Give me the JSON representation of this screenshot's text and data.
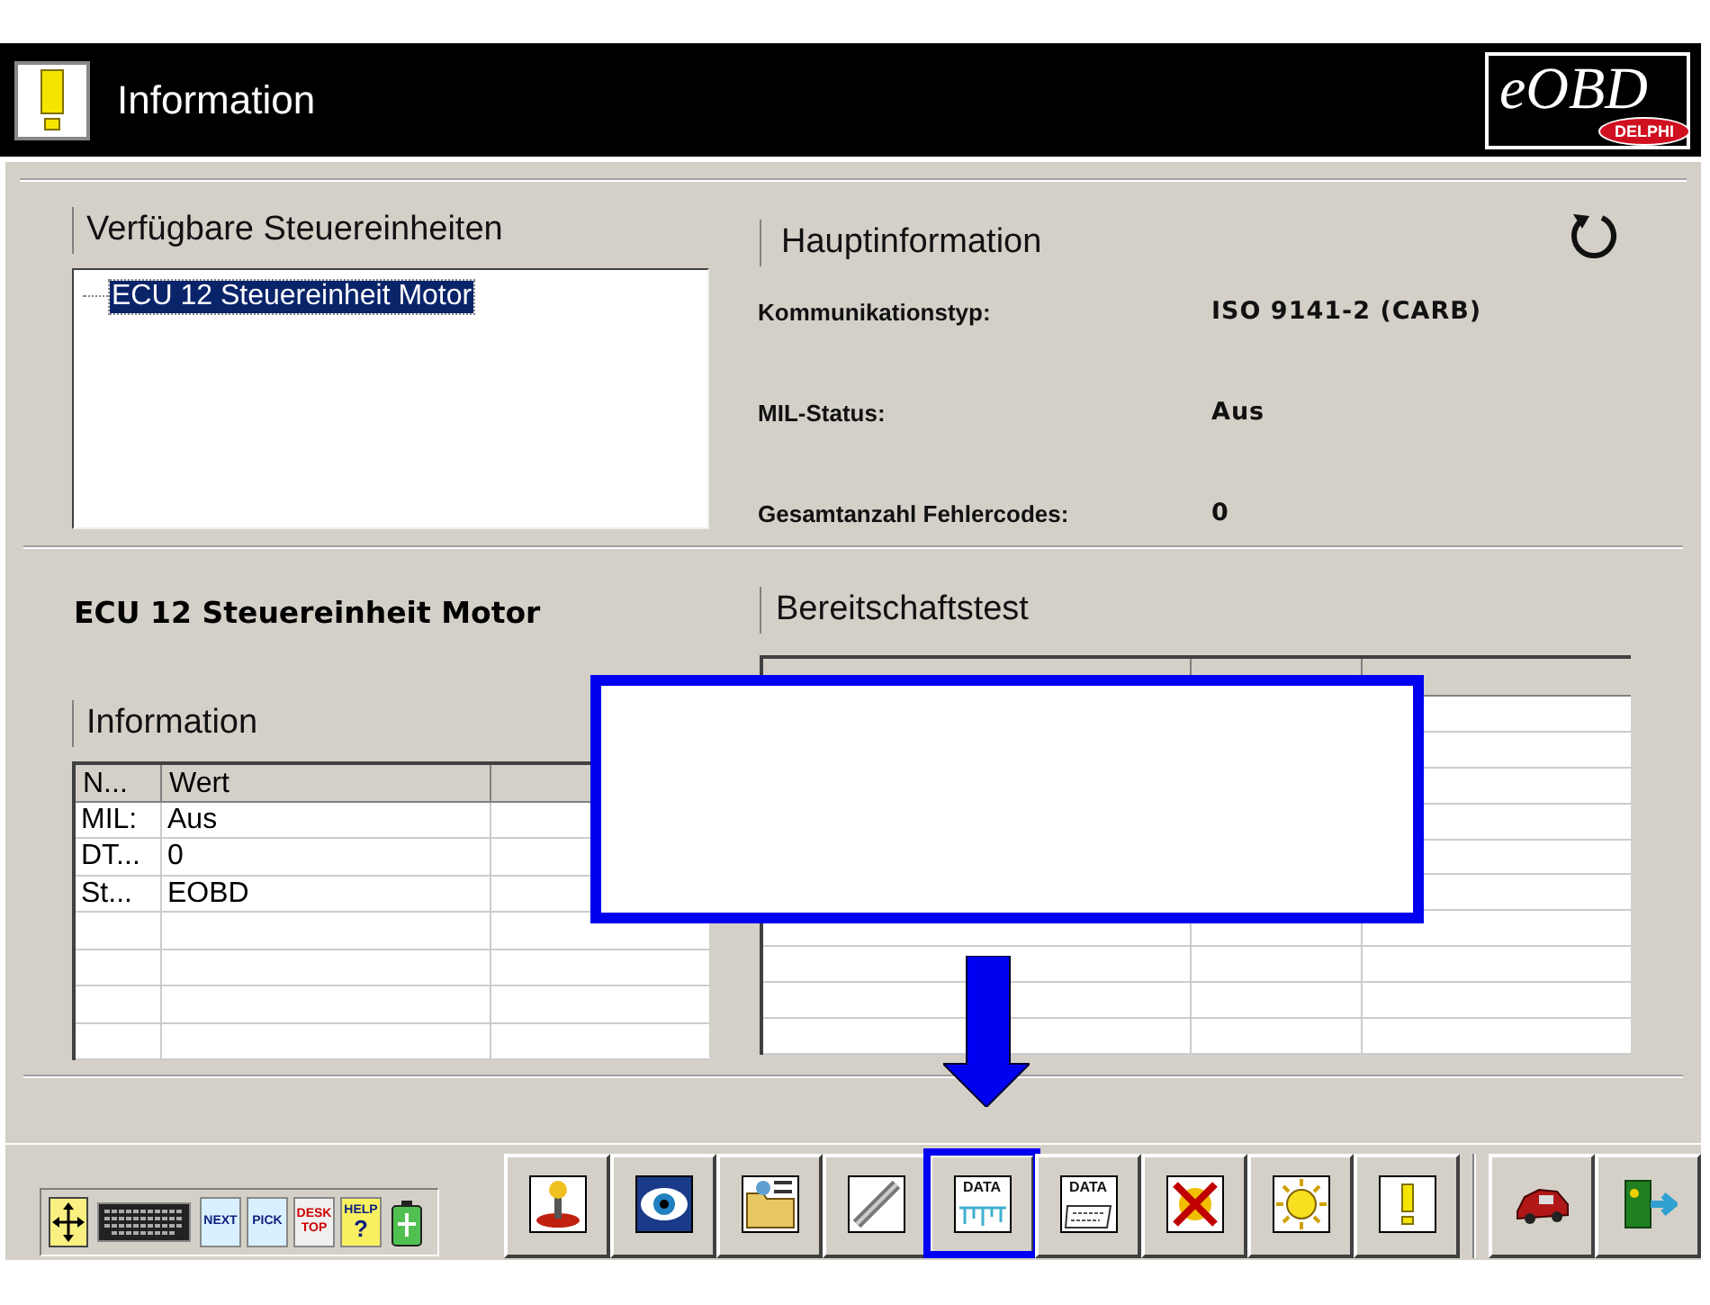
{
  "window": {
    "title": "Information"
  },
  "logo": {
    "text": "eOBD",
    "badge": "DELPHI"
  },
  "ecu_list": {
    "title": "Verfügbare Steuereinheiten",
    "items": [
      {
        "label": "ECU 12 Steuereinheit Motor",
        "selected": true
      }
    ]
  },
  "main_info": {
    "title": "Hauptinformation",
    "rows": [
      {
        "label": "Kommunikationstyp:",
        "value": "ISO 9141-2 (CARB)"
      },
      {
        "label": "MIL-Status:",
        "value": "Aus"
      },
      {
        "label": "Gesamtanzahl Fehlercodes:",
        "value": "0"
      }
    ]
  },
  "selected_ecu": "ECU 12 Steuereinheit Motor",
  "info_table": {
    "title": "Information",
    "columns": [
      "N...",
      "Wert"
    ],
    "rows": [
      [
        "MIL:",
        "Aus"
      ],
      [
        "DT...",
        "0"
      ],
      [
        "St...",
        "EOBD"
      ]
    ]
  },
  "readiness": {
    "title": "Bereitschaftstest"
  },
  "toolbar": {
    "small_tools": [
      {
        "kind": "move"
      },
      {
        "kind": "keyboard"
      },
      {
        "kind": "next",
        "label": "NEXT"
      },
      {
        "kind": "pick",
        "label": "PICK"
      },
      {
        "kind": "desktop",
        "label": "DESK TOP"
      },
      {
        "kind": "help",
        "label": "HELP",
        "glyph": "?"
      },
      {
        "kind": "battery"
      }
    ],
    "main_buttons": [
      {
        "kind": "joystick",
        "highlighted": false
      },
      {
        "kind": "eye",
        "highlighted": false
      },
      {
        "kind": "folder",
        "highlighted": false
      },
      {
        "kind": "sensor",
        "highlighted": false
      },
      {
        "kind": "data-graph",
        "label": "DATA",
        "highlighted": true
      },
      {
        "kind": "data-list",
        "label": "DATA",
        "highlighted": false
      },
      {
        "kind": "cross",
        "highlighted": false
      },
      {
        "kind": "bulb",
        "highlighted": false
      },
      {
        "kind": "alert",
        "highlighted": false
      }
    ],
    "end_buttons": [
      {
        "kind": "car",
        "highlighted": false
      },
      {
        "kind": "exit",
        "highlighted": false
      }
    ]
  },
  "annotation": {
    "callout_box": true,
    "arrow": true
  }
}
